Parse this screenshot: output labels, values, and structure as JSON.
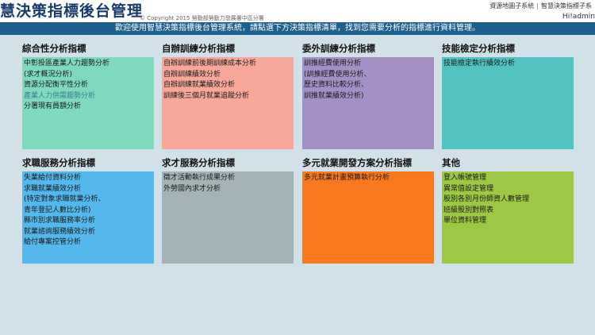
{
  "header": {
    "title": "慧決策指標後台管理",
    "copyright": "© Copyright 2015 勞動部勞動力發展署中區分署",
    "links": [
      "資源地圖子系統",
      "智慧決策指標子系"
    ],
    "user": "Hi!admin"
  },
  "welcome": "歡迎使用智慧決策指標後台管理系統，請點選下方決策指標清單，找到您需要分析的指標進行資料管理。",
  "colors": {
    "header_bg": "#ffffff",
    "title": "#1a3a6c",
    "welcome_bg": "#1f5f8b",
    "page_bg": "#d2e0e8"
  },
  "sections": [
    {
      "title": "綜合性分析指標",
      "color": "#7fd9bf",
      "items": [
        "中彰投區產業人力趨勢分析",
        "(求才概況分析)",
        "資源分配衡平性分析",
        "產業人力供需趨勢分析",
        "分署現有員額分析"
      ],
      "muted": [
        3
      ]
    },
    {
      "title": "自辦訓練分析指標",
      "color": "#f8a898",
      "items": [
        "自辦訓練前後期訓練成本分析",
        "自辦訓練績效分析",
        "自辦訓練就業績效分析",
        "訓練後三個月就業追蹤分析"
      ],
      "muted": []
    },
    {
      "title": "委外訓練分析指標",
      "color": "#a590c5",
      "items": [
        "訓推經費使用分析",
        "(訓推經費使用分析、",
        "歷史資料比較分析、",
        "訓推就業績效分析)"
      ],
      "muted": []
    },
    {
      "title": "技能檢定分析指標",
      "color": "#52c3c3",
      "items": [
        "技能檢定執行績效分析"
      ],
      "muted": []
    },
    {
      "title": "求職服務分析指標",
      "color": "#55b8ec",
      "items": [
        "失業給付資料分析",
        "求職就業績效分析",
        "(特定對象求職就業分析、",
        "青年登記人數比分析)",
        "縣市別求職服務率分析",
        "就業諮詢服務績效分析",
        "給付專案控管分析"
      ],
      "muted": []
    },
    {
      "title": "求才服務分析指標",
      "color": "#a4b4b6",
      "items": [
        "徵才活動執行成果分析",
        "外勞國內求才分析"
      ],
      "muted": []
    },
    {
      "title": "多元就業開發方案分析指標",
      "color": "#f97a1e",
      "items": [
        "多元就業計畫預算執行分析"
      ],
      "muted": []
    },
    {
      "title": "其他",
      "color": "#9dc844",
      "items": [
        "登入帳號管理",
        "異常值設定管理",
        "股別各別月份師資人數管理",
        "班級股別對照表",
        "單位資料管理"
      ],
      "muted": []
    }
  ]
}
